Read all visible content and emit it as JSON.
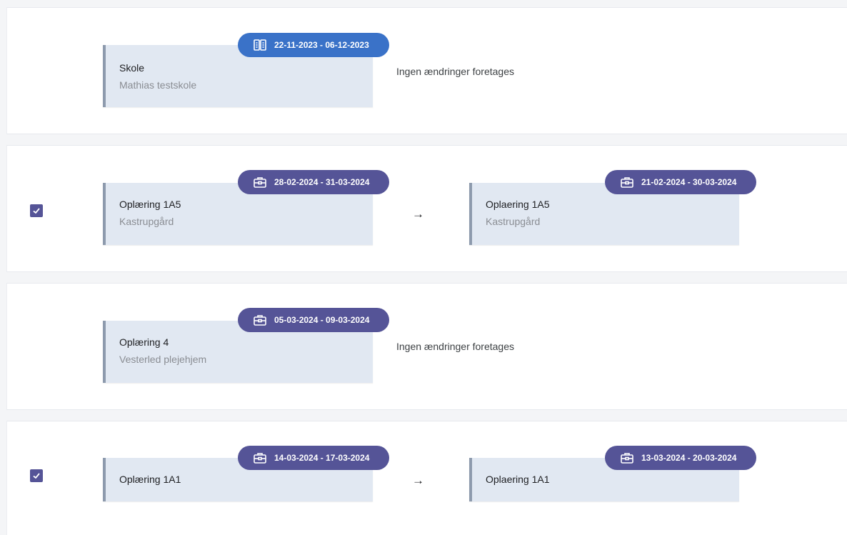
{
  "colors": {
    "school_pill": "#3a72c8",
    "work_pill": "#555497",
    "card_bg": "#e1e8f2",
    "card_border": "#8d9aad",
    "checkbox": "#555497"
  },
  "rows": [
    {
      "checked": false,
      "from": {
        "title": "Skole",
        "subtitle": "Mathias testskole",
        "date_range": "22-11-2023 - 06-12-2023",
        "icon": "school-icon"
      },
      "note": "Ingen ændringer foretages"
    },
    {
      "checked": true,
      "from": {
        "title": "Oplæring 1A5",
        "subtitle": "Kastrupgård",
        "date_range": "28-02-2024 - 31-03-2024",
        "icon": "briefcase-icon"
      },
      "arrow": "→",
      "to": {
        "title": "Oplaering 1A5",
        "subtitle": "Kastrupgård",
        "date_range": "21-02-2024 - 30-03-2024",
        "icon": "briefcase-icon"
      }
    },
    {
      "checked": false,
      "from": {
        "title": "Oplæring 4",
        "subtitle": "Vesterled plejehjem",
        "date_range": "05-03-2024 - 09-03-2024",
        "icon": "briefcase-icon"
      },
      "note": "Ingen ændringer foretages"
    },
    {
      "checked": true,
      "from": {
        "title": "Oplæring 1A1",
        "date_range": "14-03-2024 - 17-03-2024",
        "icon": "briefcase-icon"
      },
      "arrow": "→",
      "to": {
        "title": "Oplaering 1A1",
        "date_range": "13-03-2024 - 20-03-2024",
        "icon": "briefcase-icon"
      }
    }
  ]
}
